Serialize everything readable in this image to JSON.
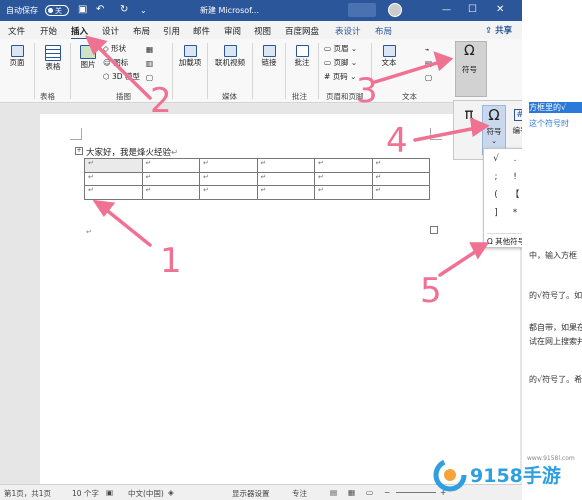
{
  "titlebar": {
    "autosave": "自动保存",
    "toggle": "关",
    "doc_title": "新建 Microsof..."
  },
  "tabs": [
    "文件",
    "开始",
    "插入",
    "设计",
    "布局",
    "引用",
    "邮件",
    "审阅",
    "视图",
    "百度网盘",
    "表设计",
    "布局"
  ],
  "share": "共享",
  "ribbon": {
    "page": "页面",
    "table": "表格",
    "picture": "图片",
    "shapes": "形状",
    "icons": "图标",
    "model3d": "3D 模型",
    "addins": "加载项",
    "online_video": "联机视频",
    "link": "链接",
    "comment": "批注",
    "header": "页眉",
    "footer": "页脚",
    "page_number": "页码",
    "text": "文本",
    "symbol": "符号",
    "groups": {
      "tables": "表格",
      "illustrations": "插图",
      "media": "媒体",
      "comments": "批注",
      "header_footer": "页眉和页脚",
      "text": "文本"
    }
  },
  "document": {
    "line1": "大家好，我是烽火经验",
    "para_mark": "↵"
  },
  "symbol_panel": {
    "equation_glyph": "π",
    "symbol_label": "符号",
    "number_label": "编号",
    "number_glyph": "#"
  },
  "symbol_dropdown": {
    "symbols": [
      "√",
      ".",
      ",",
      "、",
      ":",
      ";",
      "!",
      "?",
      "“",
      "”",
      "(",
      "【",
      "】",
      "%",
      "&",
      "]",
      "*",
      "○",
      "○",
      "□"
    ],
    "more": "其他符号(M)..."
  },
  "right_panel": [
    "方框里的√",
    "这个符号时",
    "中，输入方框",
    "的√符号了。如",
    "都自带，如果在",
    "试在网上搜索并",
    "的√符号了。希"
  ],
  "status": {
    "page": "第1页，共1页",
    "words": "10 个字",
    "lang": "中文(中国)",
    "display": "显示器设置",
    "focus": "专注"
  },
  "watermark": {
    "text": "9158手游",
    "url": "www.9158l.com"
  },
  "annotations": [
    "1",
    "2",
    "3",
    "4",
    "5"
  ],
  "colors": {
    "title_bg": "#2b579a",
    "arrow": "#f07293",
    "accent": "#2b579a"
  }
}
